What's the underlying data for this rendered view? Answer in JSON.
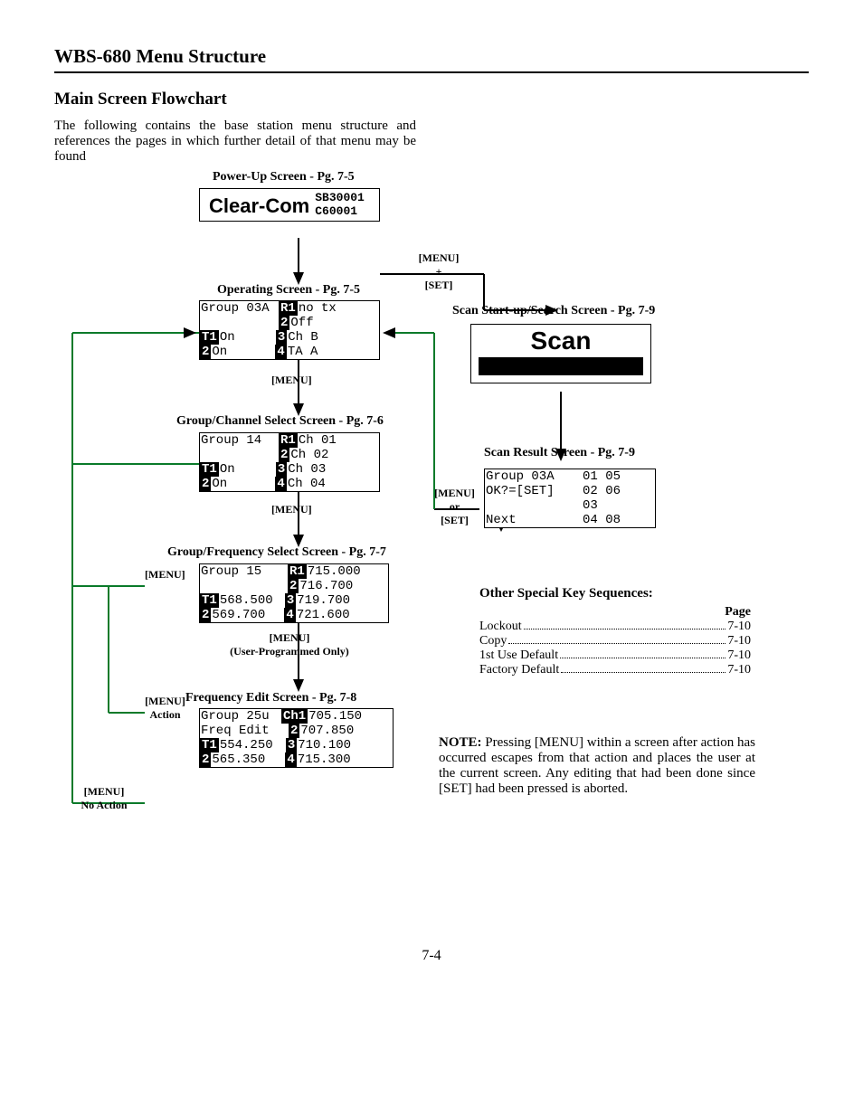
{
  "header": "WBS-680 Menu Structure",
  "subheader": "Main Screen Flowchart",
  "intro": "The following contains the base station menu structure and references the pages in which further detail of that menu may be found",
  "labels": {
    "powerup": "Power-Up Screen  - Pg. 7-5",
    "operating": "Operating Screen - Pg. 7-5",
    "groupchan": "Group/Channel Select Screen - Pg. 7-6",
    "groupfreq": "Group/Frequency Select Screen - Pg. 7-7",
    "freqedit": "Frequency Edit Screen - Pg. 7-8",
    "scanstart": "Scan Start-up/Search Screen - Pg. 7-9",
    "scanresult": "Scan Result Screen - Pg.  7-9",
    "menu": "[MENU]",
    "menu_set": "[MENU]\n+\n[SET]",
    "menu_or_set": "[MENU]\nor\n[SET]",
    "menu_user": "[MENU]\n(User-Programmed Only)",
    "menu_action": "[MENU]\nAction",
    "menu_noaction": "[MENU]\nNo Action"
  },
  "screens": {
    "powerup": {
      "brand": "Clear-Com",
      "l1": "SB30001",
      "l2": "C60001"
    },
    "operating": {
      "r1a": "Group 03A",
      "r1b": "R1",
      "r1c": "no tx",
      "r2b": "2",
      "r2c": "Off",
      "r3a": "T1",
      "r3av": "On",
      "r3b": "3",
      "r3c": "Ch B",
      "r4a": "2",
      "r4av": "On",
      "r4b": "4",
      "r4c": "TA A"
    },
    "groupchan": {
      "r1a": "Group 14",
      "r1b": "R1",
      "r1c": "Ch 01",
      "r2b": "2",
      "r2c": "Ch 02",
      "r3a": "T1",
      "r3av": "On",
      "r3b": "3",
      "r3c": "Ch 03",
      "r4a": "2",
      "r4av": "On",
      "r4b": "4",
      "r4c": "Ch 04"
    },
    "groupfreq": {
      "r1a": "Group 15",
      "r1b": "R1",
      "r1c": "715.000",
      "r2b": "2",
      "r2c": "716.700",
      "r3a": "T1",
      "r3av": "568.500",
      "r3b": "3",
      "r3c": "719.700",
      "r4a": "2",
      "r4av": "569.700",
      "r4b": "4",
      "r4c": "721.600"
    },
    "freqedit": {
      "r1a": "Group 25u",
      "r1b": "Ch1",
      "r1c": "705.150",
      "r2a": "Freq Edit",
      "r2b": "2",
      "r2c": "707.850",
      "r3a": "T1",
      "r3av": "554.250",
      "r3b": "3",
      "r3c": "710.100",
      "r4a": "2",
      "r4av": "565.350",
      "r4b": "4",
      "r4c": "715.300"
    },
    "scan": "Scan",
    "scanresult": {
      "l1a": "Group 03A",
      "l1b": "01 05",
      "l2a": "OK?=[SET]",
      "l2b": "02 06",
      "l3a": "",
      "l3b": "03",
      "l4a": "  Next",
      "l4b": "04 08"
    }
  },
  "special": {
    "title": "Other Special Key Sequences:",
    "page_label": "Page",
    "rows": [
      {
        "t": "Lockout",
        "p": "7-10"
      },
      {
        "t": "Copy",
        "p": "7-10"
      },
      {
        "t": "1st Use Default",
        "p": "7-10"
      },
      {
        "t": "Factory Default",
        "p": "7-10"
      }
    ]
  },
  "note_label": "NOTE:",
  "note": "Pressing [MENU] within a screen after action has occurred escapes from that action and places the user at the current screen. Any editing that had been done since [SET] had been pressed is aborted.",
  "pagenum": "7-4"
}
